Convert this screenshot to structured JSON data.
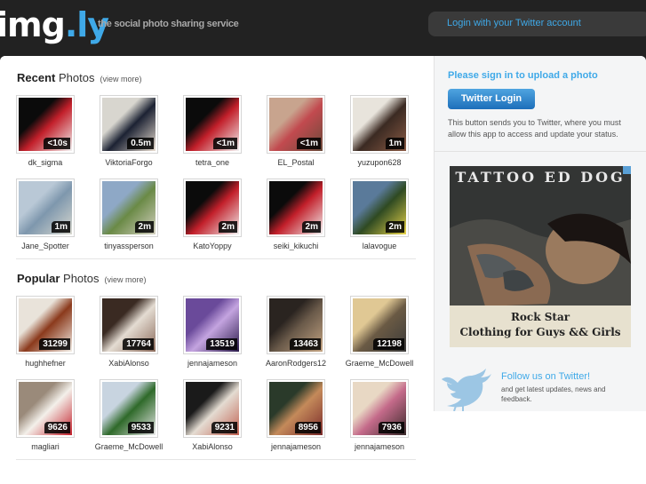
{
  "header": {
    "logo_main": "img",
    "logo_dot": ".",
    "logo_suffix": "ly",
    "tagline": "the social photo sharing service",
    "login_link": "Login with your Twitter account"
  },
  "recent": {
    "title_bold": "Recent",
    "title_rest": " Photos",
    "view_more": "(view more)",
    "items": [
      {
        "user": "dk_sigma",
        "badge": "<10s"
      },
      {
        "user": "ViktoriaForgo",
        "badge": "0.5m"
      },
      {
        "user": "tetra_one",
        "badge": "<1m"
      },
      {
        "user": "EL_Postal",
        "badge": "<1m"
      },
      {
        "user": "yuzupon628",
        "badge": "1m"
      },
      {
        "user": "Jane_Spotter",
        "badge": "1m"
      },
      {
        "user": "tinyassperson",
        "badge": "2m"
      },
      {
        "user": "KatoYoppy",
        "badge": "2m"
      },
      {
        "user": "seiki_kikuchi",
        "badge": "2m"
      },
      {
        "user": "lalavogue",
        "badge": "2m"
      }
    ]
  },
  "popular": {
    "title_bold": "Popular",
    "title_rest": " Photos",
    "view_more": "(view more)",
    "items": [
      {
        "user": "hughhefner",
        "badge": "31299"
      },
      {
        "user": "XabiAlonso",
        "badge": "17764"
      },
      {
        "user": "jennajameson",
        "badge": "13519"
      },
      {
        "user": "AaronRodgers12",
        "badge": "13463"
      },
      {
        "user": "Graeme_McDowell",
        "badge": "12198"
      },
      {
        "user": "magliari",
        "badge": "9626"
      },
      {
        "user": "Graeme_McDowell",
        "badge": "9533"
      },
      {
        "user": "XabiAlonso",
        "badge": "9231"
      },
      {
        "user": "jennajameson",
        "badge": "8956"
      },
      {
        "user": "jennajameson",
        "badge": "7936"
      }
    ]
  },
  "sidebar": {
    "signin_title": "Please sign in to upload a photo",
    "twitter_button": "Twitter Login",
    "signin_desc": "This button sends you to Twitter, where you must allow this app to access and update your status.",
    "ad_top": "TATTOO ED DOG",
    "ad_line1": "Rock Star",
    "ad_line2": "Clothing for Guys && Girls",
    "follow_title": "Follow us on Twitter!",
    "follow_desc": "and get latest updates, news and feedback."
  },
  "colors": {
    "accent": "#3fa9e8",
    "header_bg": "#222222",
    "button": "#1d6fba"
  },
  "icons": [
    "twitter-bird-icon"
  ]
}
